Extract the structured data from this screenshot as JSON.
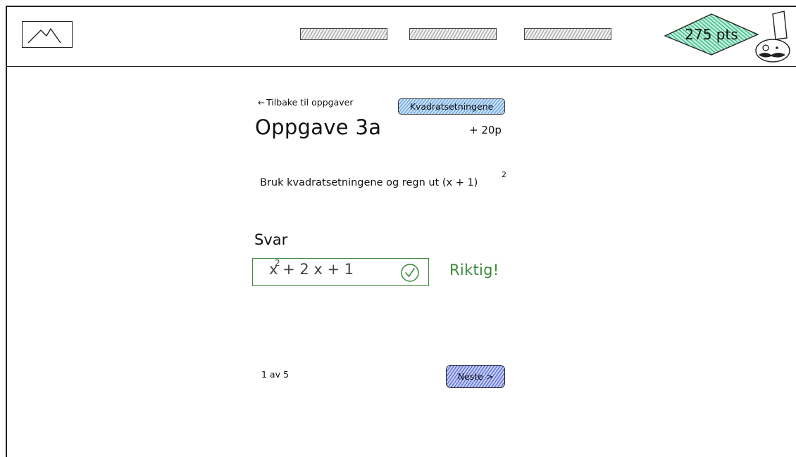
{
  "header": {
    "logo_icon": "mountain-icon",
    "nav_items": [
      "",
      "",
      ""
    ],
    "points": "275 pts",
    "avatar_icon": "chef-avatar-icon"
  },
  "task": {
    "back_link": "Tilbake til oppgaver",
    "topic_tag": "Kvadratsetningene",
    "title": "Oppgave 3a",
    "points": "+ 20p",
    "question_text": "Bruk kvadratsetningene og regn ut (x + 1)",
    "question_exponent": "2"
  },
  "answer": {
    "label": "Svar",
    "value_base": "x",
    "value_exponent": "2",
    "value_rest": " + 2 x + 1",
    "status": "Riktig!",
    "status_color": "#3a8a3a"
  },
  "footer": {
    "pager": "1 av 5",
    "next_button": "Neste >"
  },
  "colors": {
    "points_badge": "#3cbf8a",
    "topic_tag": "#6aa6e0",
    "next_button": "#5c6fd6"
  }
}
